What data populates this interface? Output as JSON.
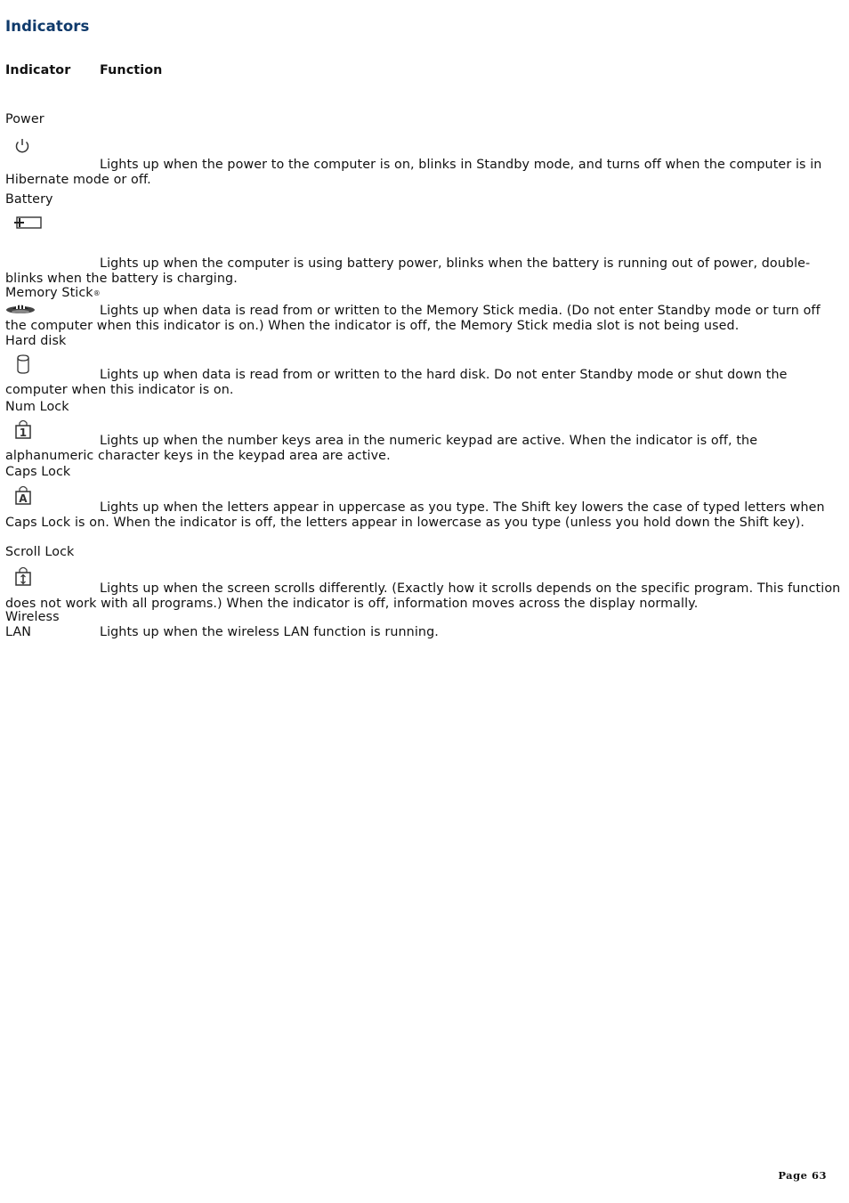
{
  "title": "Indicators",
  "table": {
    "headers": [
      "Indicator",
      "Function"
    ],
    "rows": [
      {
        "label": "Power",
        "icon": "power-icon",
        "function": "Lights up when the power to the computer is on, blinks in Standby mode, and turns off when the computer is in Hibernate mode or off."
      },
      {
        "label": "Battery",
        "icon": "battery-icon",
        "function": "Lights up when the computer is using battery power, blinks when the battery is running out of power, double-blinks when the battery is charging."
      },
      {
        "label": "Memory Stick",
        "label_sup": "®",
        "icon": "memory-stick-icon",
        "function": "Lights up when data is read from or written to the Memory Stick media. (Do not enter Standby mode or turn off the computer when this indicator is on.) When the indicator is off, the Memory Stick media slot is not being used."
      },
      {
        "label": "Hard disk",
        "icon": "hard-disk-icon",
        "function": "Lights up when data is read from or written to the hard disk. Do not enter Standby mode or shut down the computer when this indicator is on."
      },
      {
        "label": "Num Lock",
        "icon": "num-lock-icon",
        "function": "Lights up when the number keys area in the numeric keypad are active. When the indicator is off, the alphanumeric character keys in the keypad area are active."
      },
      {
        "label": "Caps Lock",
        "icon": "caps-lock-icon",
        "function": "Lights up when the letters appear in uppercase as you type. The Shift key lowers the case of typed letters when Caps Lock is on. When the indicator is off, the letters appear in lowercase as you type (unless you hold down the Shift key)."
      },
      {
        "label": "Scroll Lock",
        "icon": "scroll-lock-icon",
        "function": "Lights up when the screen scrolls differently. (Exactly how it scrolls depends on the specific program. This function does not work with all programs.) When the indicator is off, information moves across the display normally."
      },
      {
        "label_line1": "Wireless",
        "label_line2": "LAN",
        "function": "Lights up when the wireless LAN function is running."
      }
    ]
  },
  "footer": {
    "page": "Page 63"
  }
}
